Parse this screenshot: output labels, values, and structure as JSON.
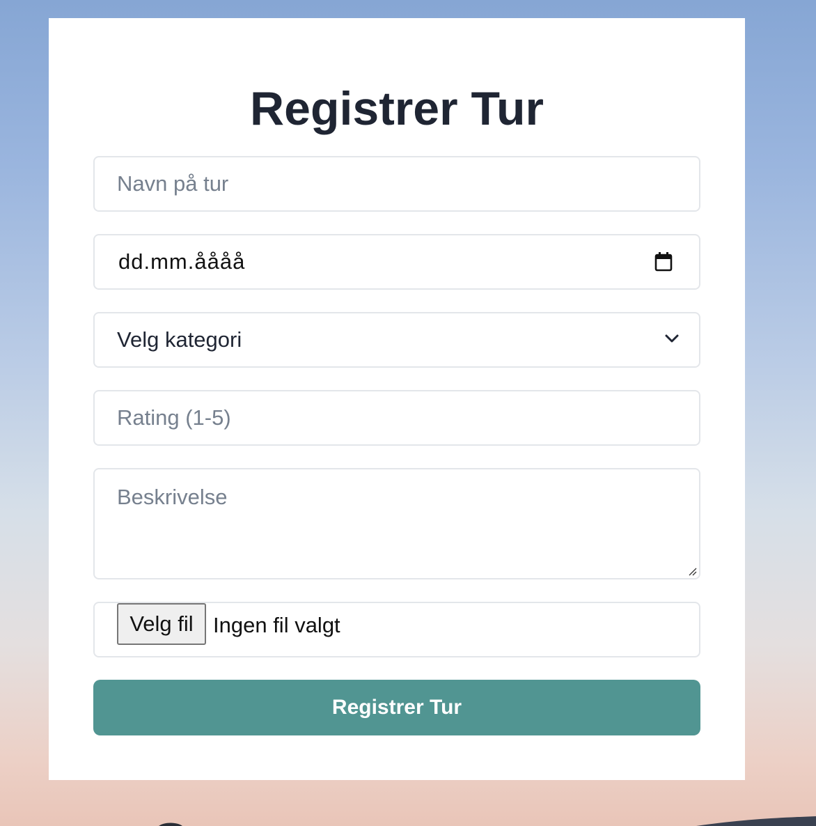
{
  "form": {
    "title": "Registrer Tur",
    "name_placeholder": "Navn på tur",
    "date_placeholder": "dd.mm.åååå",
    "category_selected": "Velg kategori",
    "rating_placeholder": "Rating (1-5)",
    "description_placeholder": "Beskrivelse",
    "file_button_label": "Velg fil",
    "file_status": "Ingen fil valgt",
    "submit_label": "Registrer Tur"
  },
  "icons": {
    "date": "calendar-icon",
    "category": "chevron-down-icon",
    "description": "resize-handle-icon"
  },
  "colors": {
    "accent": "#519592",
    "title_text": "#1f2533",
    "placeholder_text": "#76808e"
  }
}
